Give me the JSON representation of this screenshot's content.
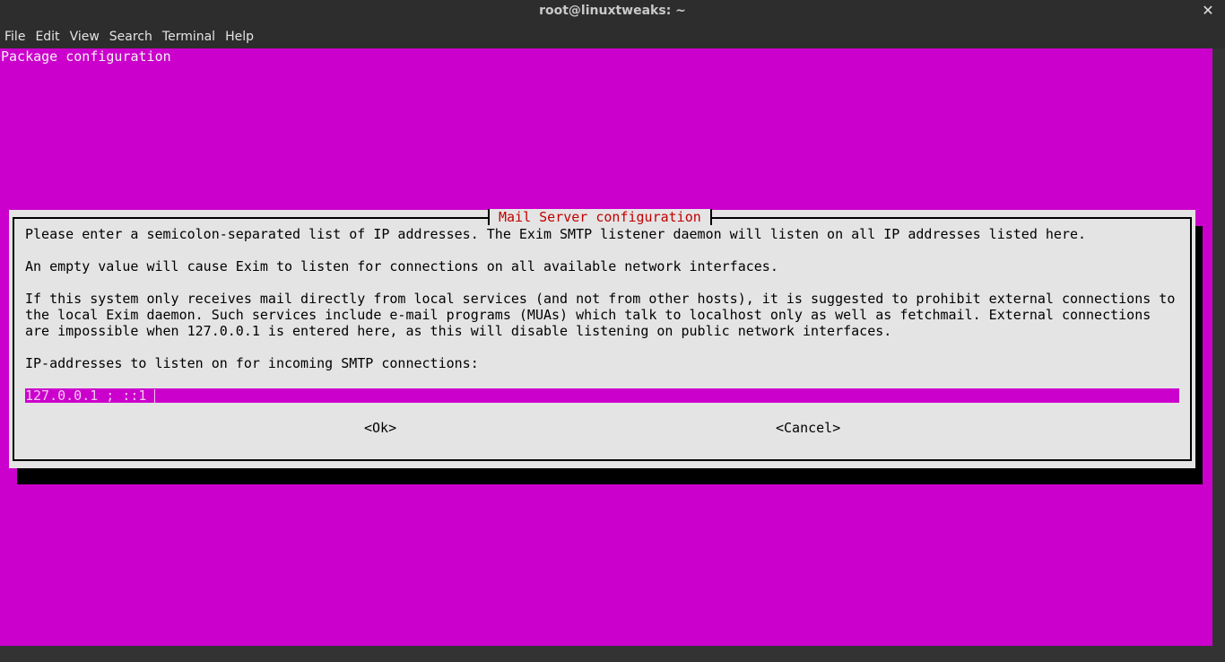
{
  "window": {
    "title": "root@linuxtweaks: ~",
    "close_glyph": "✕"
  },
  "menubar": {
    "items": [
      "File",
      "Edit",
      "Search",
      "Terminal",
      "Help"
    ]
  },
  "terminal": {
    "header": "Package configuration",
    "background_color": "#cc00cc"
  },
  "dialog": {
    "title": "Mail Server configuration",
    "paragraph1": "Please enter a semicolon-separated list of IP addresses. The Exim SMTP listener daemon will listen on all IP addresses listed here.",
    "paragraph2": "An empty value will cause Exim to listen for connections on all available network interfaces.",
    "paragraph3_lines": [
      "If this system only receives mail directly from local services (and not from other hosts), it is suggested to prohibit external connections to",
      "the local Exim daemon. Such services include e-mail programs (MUAs) which talk to localhost only as well as fetchmail. External connections",
      "are impossible when 127.0.0.1 is entered here, as this will disable listening on public network interfaces."
    ],
    "prompt": "IP-addresses to listen on for incoming SMTP connections:",
    "input_value": "127.0.0.1 ; ::1",
    "ok_label": "<Ok>",
    "cancel_label": "<Cancel>",
    "title_color": "#c00000"
  }
}
